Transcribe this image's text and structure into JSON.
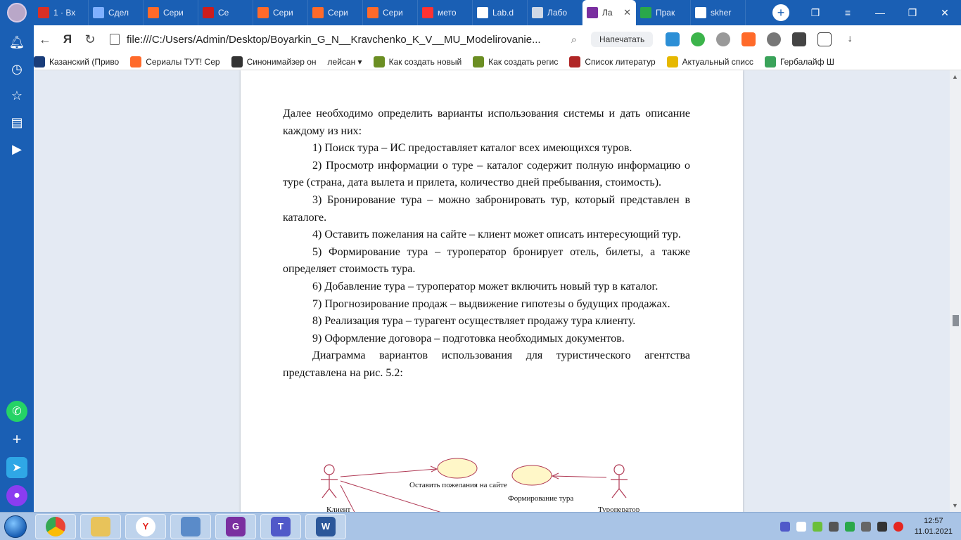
{
  "tabs": [
    {
      "label": "1 · Вх",
      "icon": "gmail-icon",
      "color": "#d93025"
    },
    {
      "label": "Сдел",
      "icon": "24-icon",
      "color": "#7fb0ff"
    },
    {
      "label": "Сери",
      "icon": "cat-icon",
      "color": "#ff6a2a"
    },
    {
      "label": "Се",
      "icon": "red-square-icon",
      "color": "#cc1d1d"
    },
    {
      "label": "Сери",
      "icon": "cat-icon",
      "color": "#ff6a2a"
    },
    {
      "label": "Сери",
      "icon": "cat-icon",
      "color": "#ff6a2a"
    },
    {
      "label": "Сери",
      "icon": "cat-icon",
      "color": "#ff6a2a"
    },
    {
      "label": "мето",
      "icon": "yandex-icon",
      "color": "#ff3333"
    },
    {
      "label": "Lab.d",
      "icon": "doc-icon",
      "color": "#ffffff"
    },
    {
      "label": "Лабо",
      "icon": "globe-icon",
      "color": "#cfd8e6"
    },
    {
      "label": "Ла",
      "icon": "pdf-icon",
      "color": "#7a2fa0",
      "active": true
    },
    {
      "label": "Прак",
      "icon": "check-icon",
      "color": "#2aa84a"
    },
    {
      "label": "skher",
      "icon": "doc-icon",
      "color": "#ffffff"
    }
  ],
  "address": {
    "url": "file:///C:/Users/Admin/Desktop/Boyarkin_G_N__Kravchenko_K_V__MU_Modelirovanie...",
    "print_label": "Напечатать"
  },
  "bookmarks": [
    {
      "label": "Казанский (Приво",
      "icon": "building-icon",
      "color": "#1a3d7a"
    },
    {
      "label": "Сериалы ТУТ! Сер",
      "icon": "cat-icon",
      "color": "#ff6a2a"
    },
    {
      "label": "Синонимайзер он",
      "icon": "star-icon",
      "color": "#333333"
    },
    {
      "label": "лейсан ▾",
      "icon": "",
      "color": ""
    },
    {
      "label": "Как создать новый",
      "icon": "s-icon",
      "color": "#6b8e23"
    },
    {
      "label": "Как создать регис",
      "icon": "s-icon",
      "color": "#6b8e23"
    },
    {
      "label": "Список литератур",
      "icon": "book-icon",
      "color": "#b02525"
    },
    {
      "label": "Актуальный списс",
      "icon": "c-icon",
      "color": "#e6b800"
    },
    {
      "label": "Гербалайф Ш",
      "icon": "leaf-icon",
      "color": "#3aa35a"
    }
  ],
  "document": {
    "p1": "Далее необходимо определить варианты использования системы и дать описание каждому из них:",
    "items": [
      "1)  Поиск тура – ИС предоставляет каталог всех имеющихся туров.",
      "2)  Просмотр информации о туре – каталог содержит полную информацию о туре (страна, дата вылета и прилета, количество дней пребывания, стоимость).",
      "3)  Бронирование тура – можно забронировать тур, который представлен в каталоге.",
      "4)  Оставить пожелания на сайте – клиент может описать интересующий тур.",
      "5)  Формирование тура – туроператор бронирует отель, билеты, а также определяет стоимость тура.",
      "6)  Добавление тура – туроператор может включить новый тур в каталог.",
      "7)  Прогнозирование продаж – выдвижение гипотезы о будущих продажах.",
      "8)  Реализация тура – турагент осуществляет продажу тура клиенту.",
      "9)  Оформление договора – подготовка необходимых документов."
    ],
    "p_last": "Диаграмма вариантов использования для туристического агентства представлена на рис. 5.2:"
  },
  "diagram": {
    "actor_client": "Клиент",
    "actor_operator": "Туроператор",
    "uc_wishes": "Оставить пожелания на сайте",
    "uc_forming": "Формирование тура",
    "ellipse_color": "#fff7c8",
    "stroke_color": "#b03a55"
  },
  "clock": {
    "time": "12:57",
    "date": "11.01.2021"
  },
  "taskbar_apps": [
    "chrome-icon",
    "explorer-icon",
    "yandex-icon",
    "control-panel-icon",
    "pdf-icon",
    "teams-icon",
    "word-icon"
  ]
}
